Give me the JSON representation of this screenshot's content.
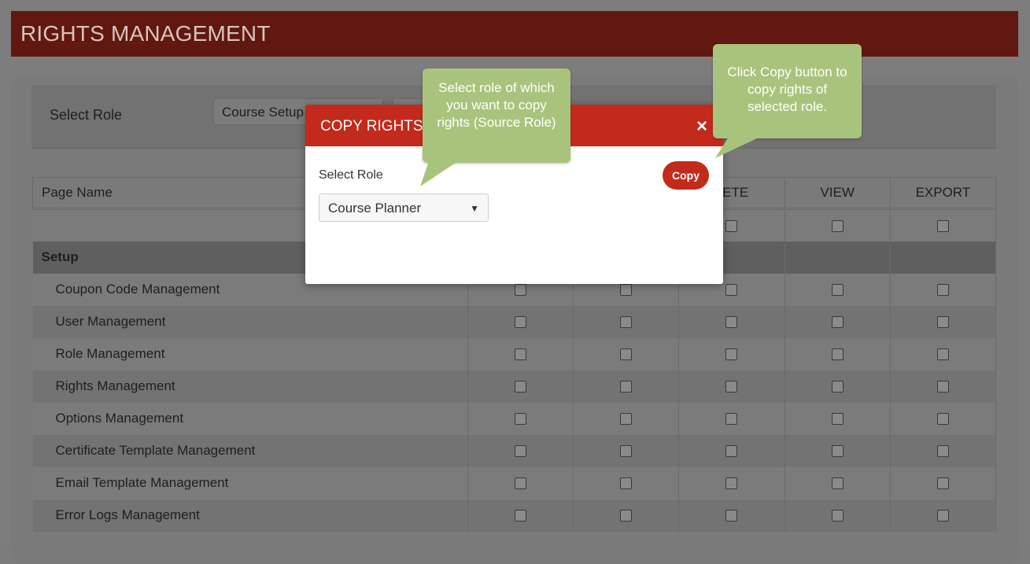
{
  "header": {
    "title": "RIGHTS MANAGEMENT"
  },
  "role_bar": {
    "label": "Select Role",
    "selected": "Course Setup"
  },
  "table": {
    "columns": [
      "Page Name",
      "",
      "",
      "LETE",
      "VIEW",
      "EXPORT"
    ],
    "group": "Setup",
    "rows": [
      "Coupon Code Management",
      "User Management",
      "Role Management",
      "Rights Management",
      "Options Management",
      "Certificate Template Management",
      "Email Template Management",
      "Error Logs Management"
    ]
  },
  "modal": {
    "title": "COPY RIGHTS",
    "close": "×",
    "label": "Select Role",
    "selected": "Course Planner",
    "copy_button": "Copy"
  },
  "callouts": {
    "source": "Select role of which you want to copy rights (Source Role)",
    "copy": "Click Copy button to copy rights of selected role."
  },
  "colors": {
    "accent": "#c32a1b",
    "callout": "#a8c47c"
  }
}
